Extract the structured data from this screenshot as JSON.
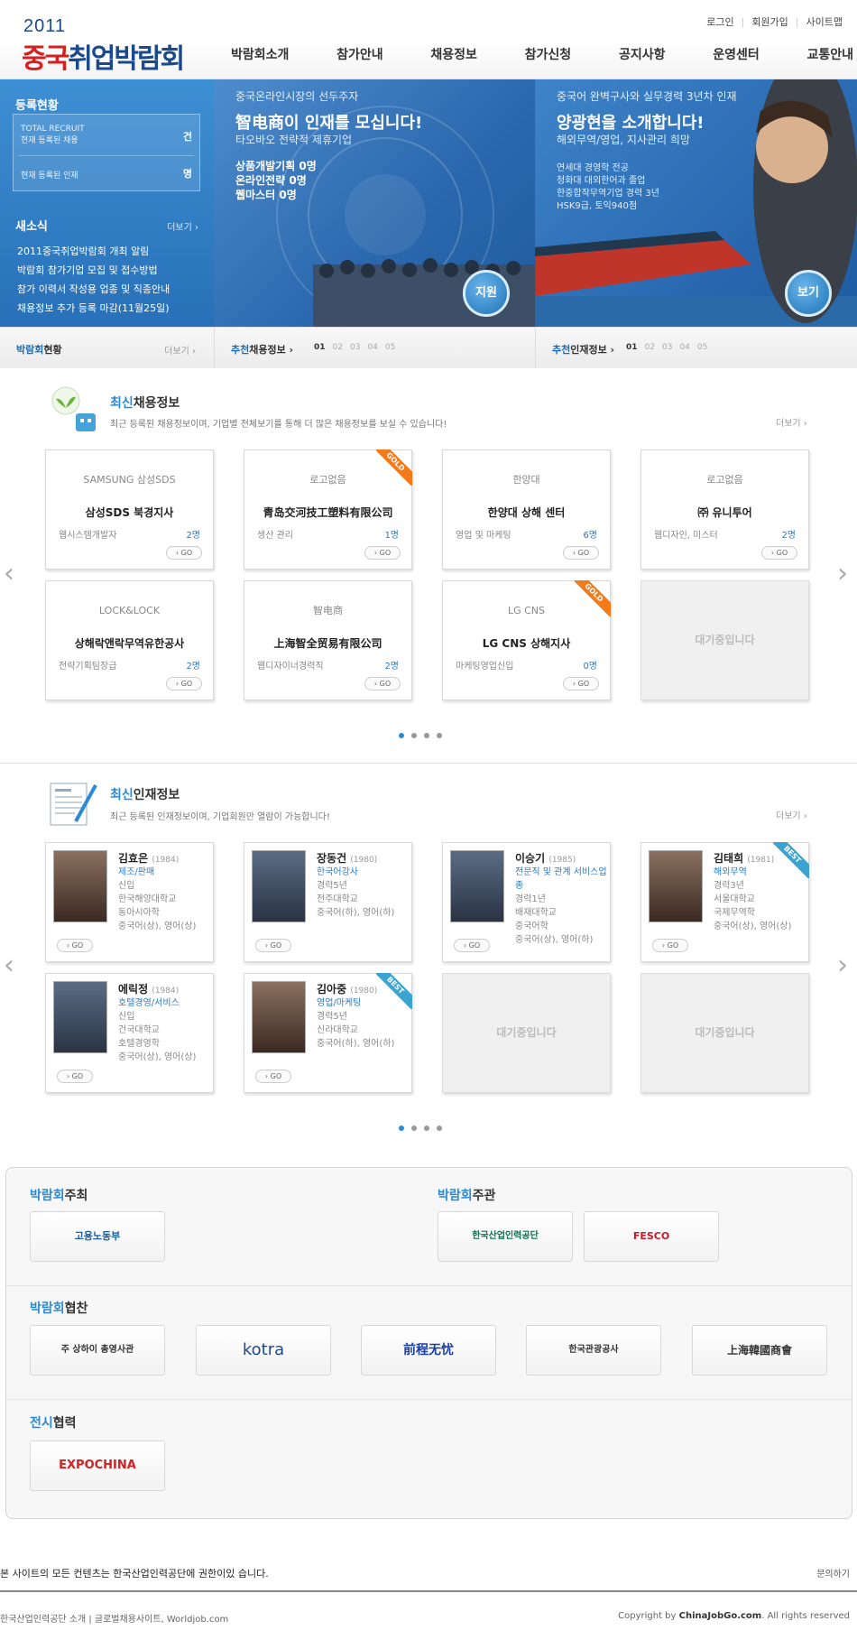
{
  "logo": {
    "year": "2011",
    "red": "중국",
    "blue": "취업박람회"
  },
  "util": [
    "로그인",
    "회원가입",
    "사이트맵"
  ],
  "gnb": [
    "박람회소개",
    "참가안내",
    "채용정보",
    "참가신청",
    "공지사항",
    "운영센터",
    "교통안내"
  ],
  "stat": {
    "label": "등록현황",
    "total_en": "TOTAL RECRUIT",
    "total_ko": "현재 등록된 채용",
    "total_unit": "건",
    "talent_ko": "현재 등록된 인재",
    "talent_unit": "명",
    "news_title": "새소식",
    "news_more": "더보기 ›",
    "news": [
      "2011중국취업박람회 개최 알림",
      "박람회 참가기업 모집 및 접수방법",
      "참가 이력서 작성용 업종 및 직종안내",
      "채용정보 추가 등록 마감(11월25일)"
    ]
  },
  "banner1": {
    "line1": "중국온라인시장의 선두주자",
    "headline": "智电商이 인재를 모십니다!",
    "sub": "타오바오 전략적 제휴기업",
    "jobs": [
      "상품개발기획 0명",
      "온라인전략 0명",
      "웹마스터 0명"
    ],
    "cta": "지원"
  },
  "banner2": {
    "line1": "중국어 완벽구사와 실무경력 3년차 인재",
    "headline": "양광현을 소개합니다!",
    "sub": "해외무역/영업, 지사관리 희망",
    "details": [
      "연세대 경영학 전공",
      "청화대 대외한어과 졸업",
      "한중합작무역기업 경력 3년",
      "HSK9급, 토익940점"
    ],
    "cta": "보기"
  },
  "bar": {
    "b1_o": "박람회",
    "b1": "현황",
    "b1_more": "더보기 ›",
    "b2_o": "추천",
    "b2": "채용정보 ›",
    "b3_o": "추천",
    "b3": "인재정보 ›",
    "pages": [
      "01",
      "02",
      "03",
      "04",
      "05"
    ]
  },
  "jobs_section": {
    "title_o": "최신",
    "title": "채용정보",
    "desc": "최근 등록된 채용정보이며, 기업별 전체보기를 통해 더 많은 채용정보를 보실 수 있습니다!",
    "more": "더보기 ›",
    "go": "› GO",
    "wait": "대기중입니다",
    "cards": [
      {
        "logo": "SAMSUNG  삼성SDS",
        "name": "삼성SDS 북경지사",
        "job": "웹시스템개발자",
        "count": "2명",
        "ribbon": ""
      },
      {
        "logo": "로고없음",
        "name": "青岛交河技工塑料有限公司",
        "job": "생산 관리",
        "count": "1명",
        "ribbon": "GOLD"
      },
      {
        "logo": "한양대",
        "name": "한양대 상해 센터",
        "job": "영업 및 마케팅",
        "count": "6명",
        "ribbon": ""
      },
      {
        "logo": "로고없음",
        "name": "㈜ 유니투어",
        "job": "웹디자인, 미스터",
        "count": "2명",
        "ribbon": ""
      },
      {
        "logo": "LOCK&LOCK",
        "name": "상해락앤락무역유한공사",
        "job": "전략기획팀장급",
        "count": "2명",
        "ribbon": ""
      },
      {
        "logo": "智电商",
        "name": "上海智全贸易有限公司",
        "job": "웹디자이너경력직",
        "count": "2명",
        "ribbon": ""
      },
      {
        "logo": "LG CNS",
        "name": "LG CNS 상해지사",
        "job": "마케팅영업신입",
        "count": "0명",
        "ribbon": "GOLD"
      }
    ]
  },
  "talent_section": {
    "title_o": "최신",
    "title": "인재정보",
    "desc": "최근 등록된 인재정보이며, 기업회원만 열람이 가능합니다!",
    "more": "더보기 ›",
    "go": "› GO",
    "wait": "대기중입니다",
    "people": [
      {
        "name": "김효은",
        "year": "(1984)",
        "field": "제조/판매",
        "lines": [
          "신입",
          "한국해양대학교",
          "동아시아학",
          "중국어(상), 영어(상)"
        ],
        "ribbon": ""
      },
      {
        "name": "장동건",
        "year": "(1980)",
        "field": "한국어강사",
        "lines": [
          "경력5년",
          "전주대학교",
          "중국어(하), 영어(하)"
        ],
        "ribbon": ""
      },
      {
        "name": "이승기",
        "year": "(1985)",
        "field": "전문직 및 관계 서비스업종",
        "lines": [
          "경력1년",
          "배재대학교",
          "중국어학",
          "중국어(상), 영어(하)"
        ],
        "ribbon": ""
      },
      {
        "name": "김태희",
        "year": "(1981)",
        "field": "해외무역",
        "lines": [
          "경력3년",
          "서울대학교",
          "국제무역학",
          "중국어(상), 영어(상)"
        ],
        "ribbon": "BEST"
      },
      {
        "name": "에릭정",
        "year": "(1984)",
        "field": "호텔경영/서비스",
        "lines": [
          "신입",
          "건국대학교",
          "호텔경영학",
          "중국어(상), 영어(상)"
        ],
        "ribbon": ""
      },
      {
        "name": "김아중",
        "year": "(1980)",
        "field": "영업/마케팅",
        "lines": [
          "경력5년",
          "신라대학교",
          "중국어(하), 영어(하)"
        ],
        "ribbon": "BEST"
      }
    ]
  },
  "partners": {
    "host_o": "박람회",
    "host": "주최",
    "org_o": "박람회",
    "org": "주관",
    "spon_o": "박람회",
    "spon": "협찬",
    "exh_o": "전시",
    "exh": "협력",
    "host_logos": [
      "고용노동부"
    ],
    "org_logos": [
      "한국산업인력공단",
      "FESCO"
    ],
    "spon_logos": [
      "주 상하이 총영사관",
      "kotra",
      "前程无忧",
      "한국관광공사",
      "上海韓國商會"
    ],
    "exh_logos": [
      "EXPOCHINA"
    ]
  },
  "footer": {
    "notice": "본 사이트의 모든 컨텐츠는 한국산업인력공단에 권한이있 습니다.",
    "contact": "문의하기",
    "links": "한국산업인력공단 소개   |   글로벌채용사이트, Worldjob.com",
    "copyright_pre": "Copyright by ",
    "copyright_site": "ChinaJobGo.com",
    "copyright_post": ". All rights reserved"
  }
}
